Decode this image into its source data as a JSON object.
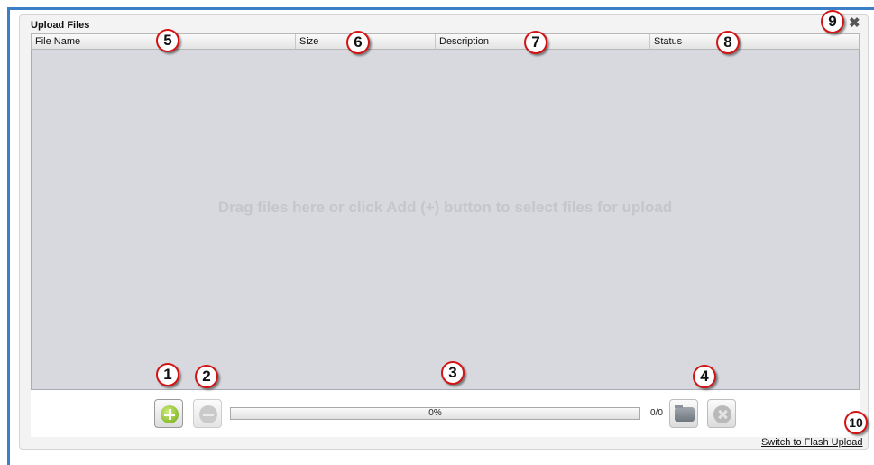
{
  "dialog": {
    "title": "Upload Files",
    "close_icon": "close-icon",
    "close_glyph": "✖"
  },
  "columns": [
    "File Name",
    "Size",
    "Description",
    "Status"
  ],
  "drop_zone": {
    "text": "Drag files here or click Add (+) button to select files for upload"
  },
  "toolbar": {
    "add_icon": "add-icon",
    "remove_icon": "remove-icon",
    "progress_label": "0%",
    "progress_value": 0,
    "file_count": "0/0",
    "upload_icon": "upload-icon",
    "cancel_icon": "cancel-icon"
  },
  "switch_link": "Switch to Flash Upload",
  "callouts": [
    "1",
    "2",
    "3",
    "4",
    "5",
    "6",
    "7",
    "8",
    "9",
    "10"
  ],
  "colors": {
    "accent_border": "#3d7fc7",
    "drop_zone_bg": "#d7d9de",
    "callout_ring": "#d21414",
    "add_green": "#6ea80f"
  }
}
